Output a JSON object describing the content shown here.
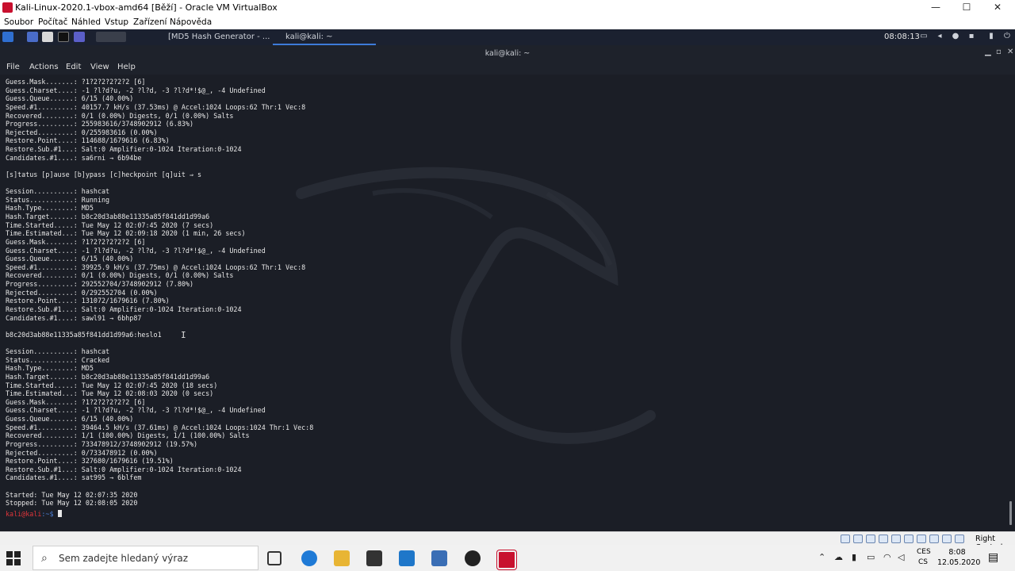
{
  "vbox": {
    "title": "Kali-Linux-2020.1-vbox-amd64 [Běží] - Oracle VM VirtualBox",
    "minimize": "—",
    "maximize": "☐",
    "close": "✕",
    "menu": [
      "Soubor",
      "Počítač",
      "Náhled",
      "Vstup",
      "Zařízení",
      "Nápověda"
    ],
    "host_key": "Right Control"
  },
  "kali_panel": {
    "tasks": [
      {
        "label": "[MD5 Hash Generator - ...",
        "active": false
      },
      {
        "label": "kali@kali: ~",
        "active": true
      }
    ],
    "clock": "08:08:13"
  },
  "terminal": {
    "window_title": "kali@kali: ~",
    "menu": [
      "File",
      "Actions",
      "Edit",
      "View",
      "Help"
    ],
    "lines": [
      "Guess.Mask.......: ?1?2?2?2?2?2 [6]",
      "Guess.Charset....: -1 ?l?d?u, -2 ?l?d, -3 ?l?d*!$@_, -4 Undefined",
      "Guess.Queue......: 6/15 (40.00%)",
      "Speed.#1.........: 40157.7 kH/s (37.53ms) @ Accel:1024 Loops:62 Thr:1 Vec:8",
      "Recovered........: 0/1 (0.00%) Digests, 0/1 (0.00%) Salts",
      "Progress.........: 255983616/3748902912 (6.83%)",
      "Rejected.........: 0/255983616 (0.00%)",
      "Restore.Point....: 114688/1679616 (6.83%)",
      "Restore.Sub.#1...: Salt:0 Amplifier:0-1024 Iteration:0-1024",
      "Candidates.#1....: sa6rni → 6b94be",
      "",
      "[s]tatus [p]ause [b]ypass [c]heckpoint [q]uit ⇒ s",
      "",
      "Session..........: hashcat",
      "Status...........: Running",
      "Hash.Type........: MD5",
      "Hash.Target......: b8c20d3ab88e11335a85f841dd1d99a6",
      "Time.Started.....: Tue May 12 02:07:45 2020 (7 secs)",
      "Time.Estimated...: Tue May 12 02:09:18 2020 (1 min, 26 secs)",
      "Guess.Mask.......: ?1?2?2?2?2?2 [6]",
      "Guess.Charset....: -1 ?l?d?u, -2 ?l?d, -3 ?l?d*!$@_, -4 Undefined",
      "Guess.Queue......: 6/15 (40.00%)",
      "Speed.#1.........: 39925.9 kH/s (37.75ms) @ Accel:1024 Loops:62 Thr:1 Vec:8",
      "Recovered........: 0/1 (0.00%) Digests, 0/1 (0.00%) Salts",
      "Progress.........: 292552704/3748902912 (7.80%)",
      "Rejected.........: 0/292552704 (0.00%)",
      "Restore.Point....: 131072/1679616 (7.80%)",
      "Restore.Sub.#1...: Salt:0 Amplifier:0-1024 Iteration:0-1024",
      "Candidates.#1....: sawl91 → 6bhp87",
      "",
      "b8c20d3ab88e11335a85f841dd1d99a6:heslo1",
      "",
      "Session..........: hashcat",
      "Status...........: Cracked",
      "Hash.Type........: MD5",
      "Hash.Target......: b8c20d3ab88e11335a85f841dd1d99a6",
      "Time.Started.....: Tue May 12 02:07:45 2020 (18 secs)",
      "Time.Estimated...: Tue May 12 02:08:03 2020 (0 secs)",
      "Guess.Mask.......: ?1?2?2?2?2?2 [6]",
      "Guess.Charset....: -1 ?l?d?u, -2 ?l?d, -3 ?l?d*!$@_, -4 Undefined",
      "Guess.Queue......: 6/15 (40.00%)",
      "Speed.#1.........: 39464.5 kH/s (37.61ms) @ Accel:1024 Loops:1024 Thr:1 Vec:8",
      "Recovered........: 1/1 (100.00%) Digests, 1/1 (100.00%) Salts",
      "Progress.........: 733478912/3748902912 (19.57%)",
      "Rejected.........: 0/733478912 (0.00%)",
      "Restore.Point....: 327680/1679616 (19.51%)",
      "Restore.Sub.#1...: Salt:0 Amplifier:0-1024 Iteration:0-1024",
      "Candidates.#1....: sat995 → 6blfem",
      "",
      "Started: Tue May 12 02:07:35 2020",
      "Stopped: Tue May 12 02:08:05 2020"
    ],
    "prompt_user": "kali@kali",
    "prompt_path": ":~$ "
  },
  "windows": {
    "search_placeholder": "Sem zadejte hledaný výraz",
    "ime_lang": "CES",
    "ime_sub": "CS",
    "time": "8:08",
    "date": "12.05.2020"
  }
}
